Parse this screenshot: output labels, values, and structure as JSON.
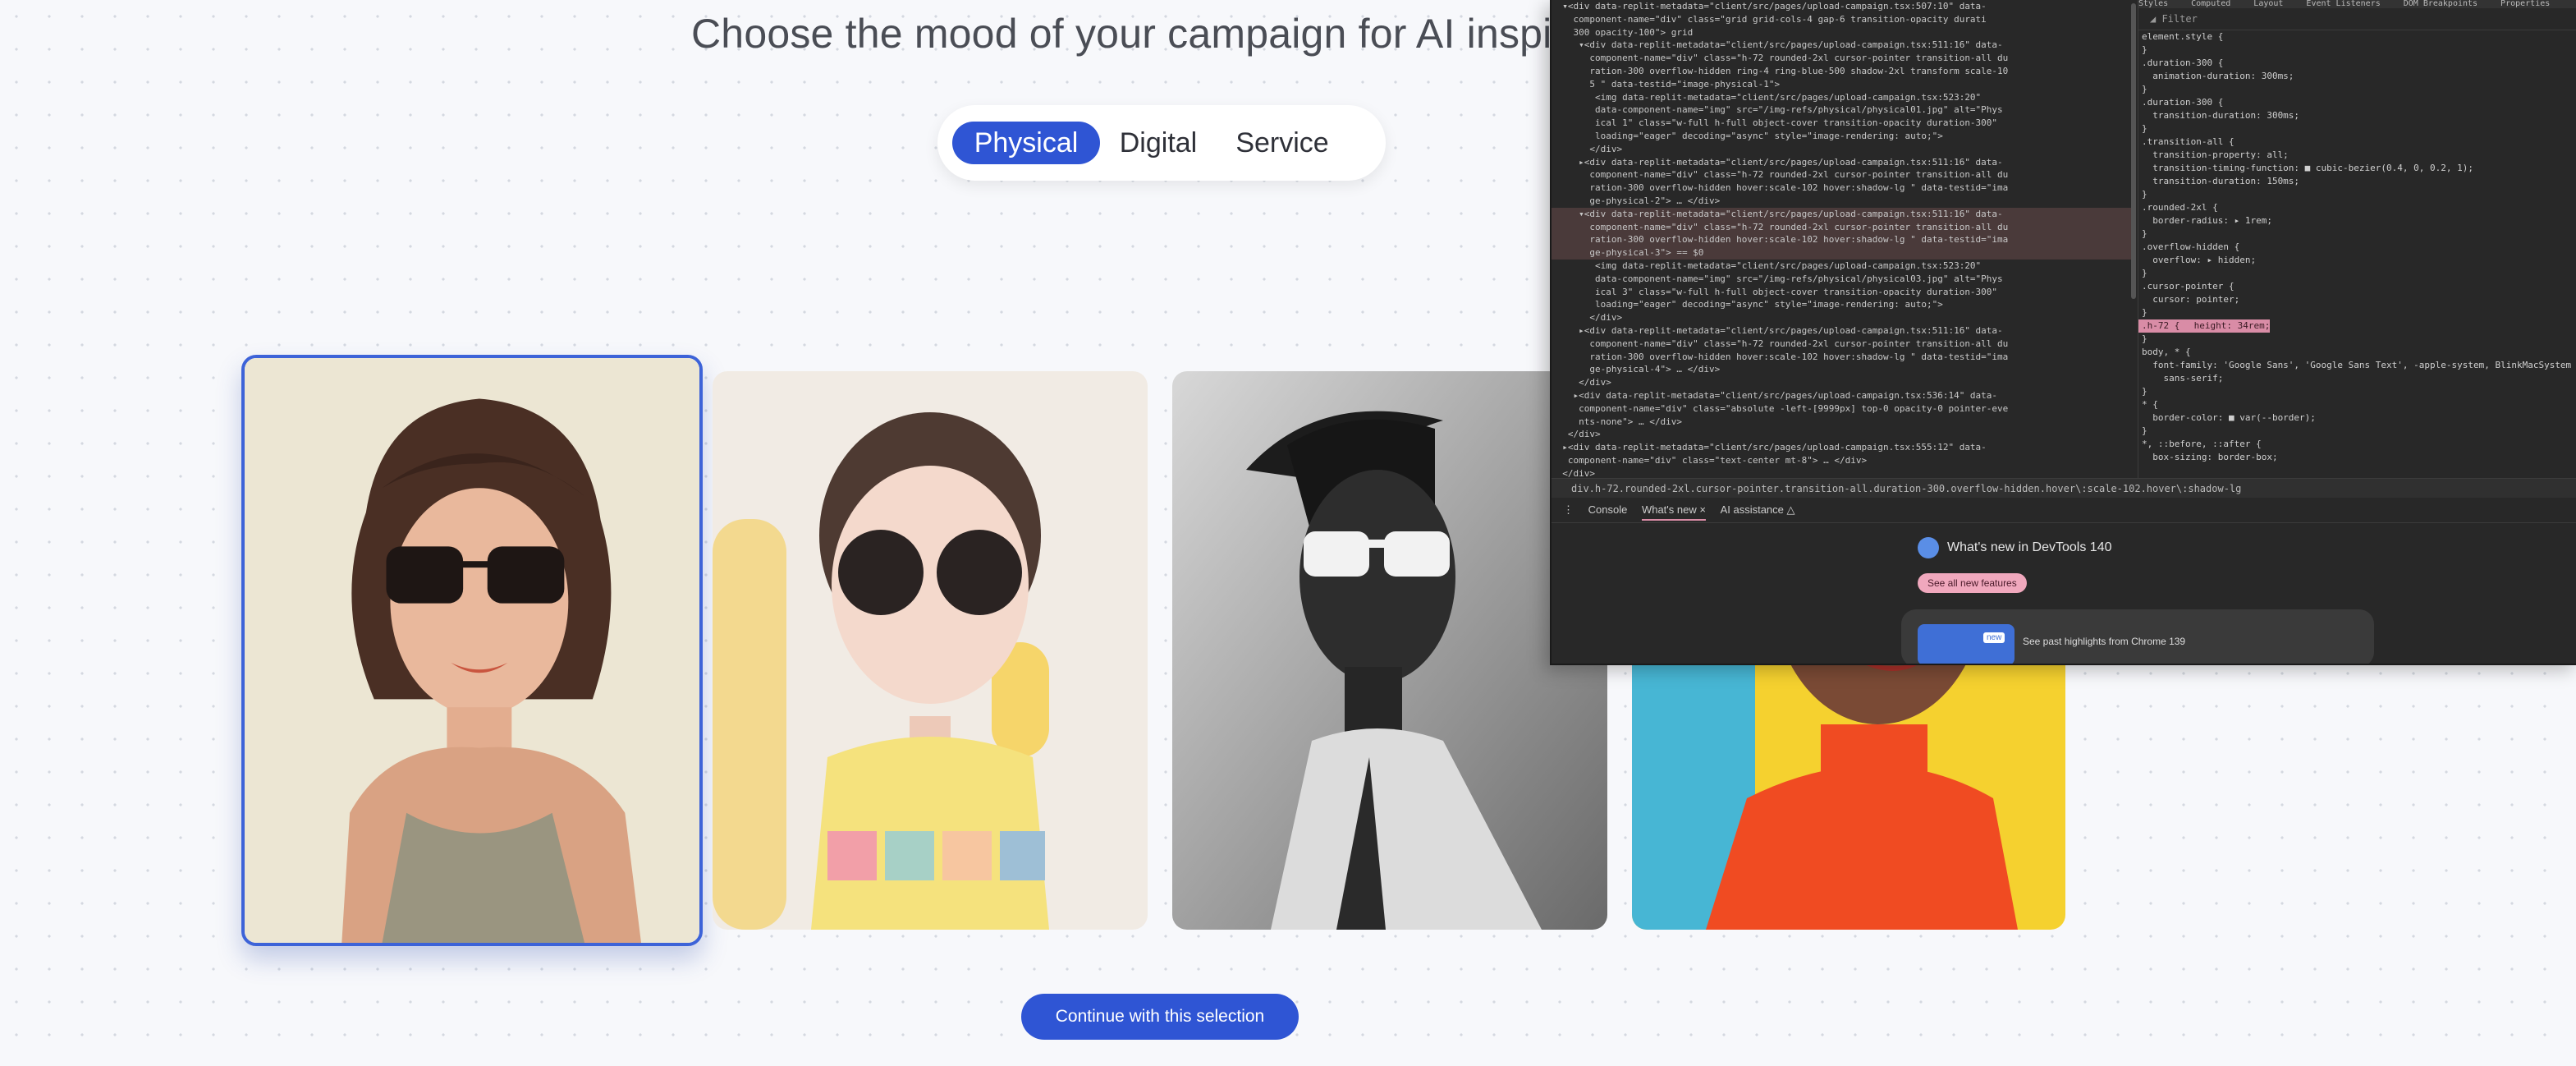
{
  "page": {
    "title": "Choose the mood of your campaign for AI inspira",
    "tabs": [
      {
        "label": "Physical",
        "active": true
      },
      {
        "label": "Digital",
        "active": false
      },
      {
        "label": "Service",
        "active": false
      }
    ],
    "cards": [
      {
        "alt": "Physical 1",
        "selected": true
      },
      {
        "alt": "Physical 2",
        "selected": false
      },
      {
        "alt": "Physical 3",
        "selected": false
      },
      {
        "alt": "Physical 4",
        "selected": false
      }
    ],
    "continue_label": "Continue with this selection",
    "colors": {
      "accent": "#2f55d4",
      "selected_border": "#3d63d8"
    }
  },
  "devtools": {
    "elements_lines": [
      "  ▾<div data-replit-metadata=\"client/src/pages/upload-campaign.tsx:507:10\" data-",
      "    component-name=\"div\" class=\"grid grid-cols-4 gap-6 transition-opacity durati",
      "    300 opacity-100\"> grid",
      "     ▾<div data-replit-metadata=\"client/src/pages/upload-campaign.tsx:511:16\" data-",
      "       component-name=\"div\" class=\"h-72 rounded-2xl cursor-pointer transition-all du",
      "       ration-300 overflow-hidden ring-4 ring-blue-500 shadow-2xl transform scale-10",
      "       5 \" data-testid=\"image-physical-1\">",
      "        <img data-replit-metadata=\"client/src/pages/upload-campaign.tsx:523:20\"",
      "        data-component-name=\"img\" src=\"/img-refs/physical/physical01.jpg\" alt=\"Phys",
      "        ical 1\" class=\"w-full h-full object-cover transition-opacity duration-300\"",
      "        loading=\"eager\" decoding=\"async\" style=\"image-rendering: auto;\">",
      "       </div>",
      "     ▸<div data-replit-metadata=\"client/src/pages/upload-campaign.tsx:511:16\" data-",
      "       component-name=\"div\" class=\"h-72 rounded-2xl cursor-pointer transition-all du",
      "       ration-300 overflow-hidden hover:scale-102 hover:shadow-lg \" data-testid=\"ima",
      "       ge-physical-2\"> … </div>",
      "     ▾<div data-replit-metadata=\"client/src/pages/upload-campaign.tsx:511:16\" data-",
      "       component-name=\"div\" class=\"h-72 rounded-2xl cursor-pointer transition-all du",
      "       ration-300 overflow-hidden hover:scale-102 hover:shadow-lg \" data-testid=\"ima",
      "       ge-physical-3\"> == $0",
      "        <img data-replit-metadata=\"client/src/pages/upload-campaign.tsx:523:20\"",
      "        data-component-name=\"img\" src=\"/img-refs/physical/physical03.jpg\" alt=\"Phys",
      "        ical 3\" class=\"w-full h-full object-cover transition-opacity duration-300\"",
      "        loading=\"eager\" decoding=\"async\" style=\"image-rendering: auto;\">",
      "       </div>",
      "     ▸<div data-replit-metadata=\"client/src/pages/upload-campaign.tsx:511:16\" data-",
      "       component-name=\"div\" class=\"h-72 rounded-2xl cursor-pointer transition-all du",
      "       ration-300 overflow-hidden hover:scale-102 hover:shadow-lg \" data-testid=\"ima",
      "       ge-physical-4\"> … </div>",
      "     </div>",
      "    ▸<div data-replit-metadata=\"client/src/pages/upload-campaign.tsx:536:14\" data-",
      "     component-name=\"div\" class=\"absolute -left-[9999px] top-0 opacity-0 pointer-eve",
      "     nts-none\"> … </div>",
      "   </div>",
      "  ▸<div data-replit-metadata=\"client/src/pages/upload-campaign.tsx:555:12\" data-",
      "   component-name=\"div\" class=\"text-center mt-8\"> … </div>",
      "  </div>",
      " ▸<div data-replit-metadata=\"client/src/pages/upload-campaign.tsx:573:10\" data-"
    ],
    "highlight_line_index": 16,
    "styles_tabs": [
      "Styles",
      "Computed",
      "Layout",
      "Event Listeners",
      "DOM Breakpoints",
      "Properties"
    ],
    "filter_placeholder": "Filter",
    "styles_lines": [
      "element.style {",
      "}",
      ".duration-300 {",
      "  animation-duration: 300ms;",
      "}",
      ".duration-300 {",
      "  transition-duration: 300ms;",
      "}",
      ".transition-all {",
      "  transition-property: all;",
      "  transition-timing-function: ■ cubic-bezier(0.4, 0, 0.2, 1);",
      "  transition-duration: 150ms;",
      "}",
      ".rounded-2xl {",
      "  border-radius: ▸ 1rem;",
      "}",
      ".overflow-hidden {",
      "  overflow: ▸ hidden;",
      "}",
      ".cursor-pointer {",
      "  cursor: pointer;",
      "}",
      ".h-72 {",
      "  height: 34rem;",
      "}",
      "body, * {",
      "  font-family: 'Google Sans', 'Google Sans Text', -apple-system, BlinkMacSystem",
      "    sans-serif;",
      "}",
      "* {",
      "  border-color: ■ var(--border);",
      "}",
      "*, ::before, ::after {",
      "  box-sizing: border-box;"
    ],
    "breadcrumb": "div.h-72.rounded-2xl.cursor-pointer.transition-all.duration-300.overflow-hidden.hover\\:scale-102.hover\\:shadow-lg",
    "drawer_tabs": [
      "Console",
      "What's new ×",
      "AI assistance △"
    ],
    "whats_new_title": "What's new in DevTools 140",
    "see_features": "See all new features",
    "highlight_new": "new",
    "highlight_text": "See past highlights from Chrome 139"
  }
}
